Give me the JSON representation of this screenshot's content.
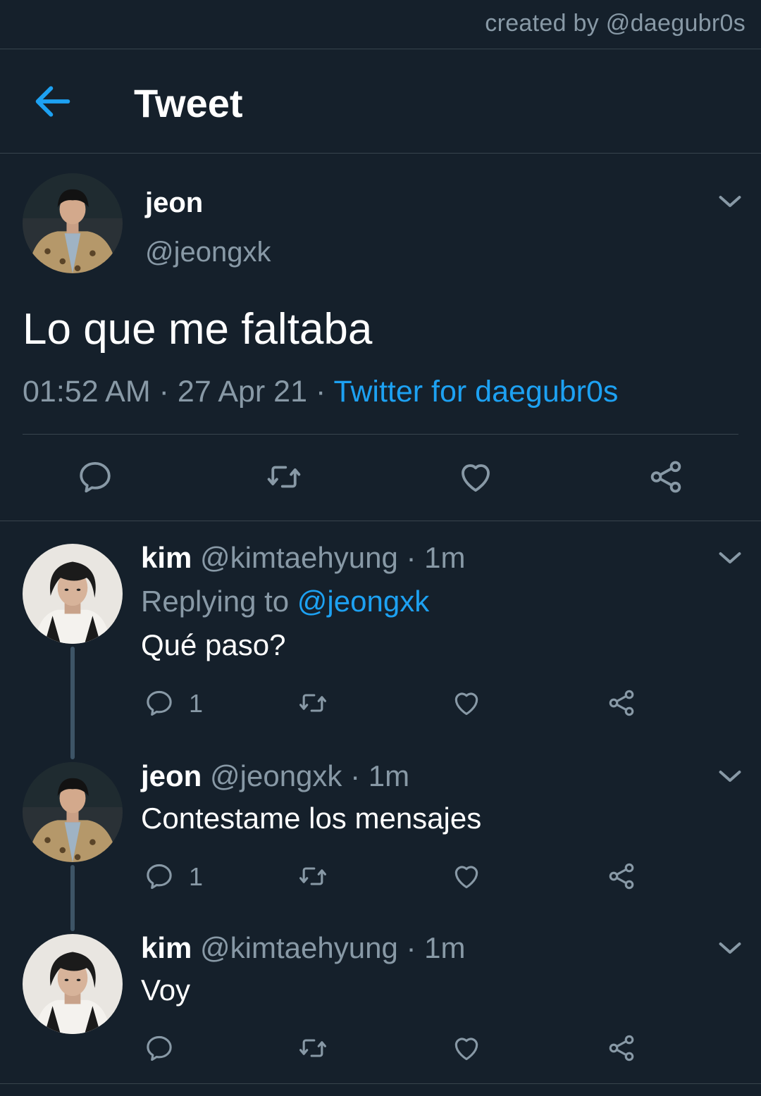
{
  "watermark": "created by @daegubr0s",
  "header": {
    "title": "Tweet"
  },
  "main_tweet": {
    "name": "jeon",
    "handle": "@jeongxk",
    "text": "Lo que me faltaba",
    "time": "01:52 AM",
    "date": "27 Apr 21",
    "separator": "·",
    "source": "Twitter for daegubr0s"
  },
  "replies": [
    {
      "name": "kim",
      "handle": "@kimtaehyung",
      "time": "1m",
      "replying_prefix": "Replying to",
      "replying_to": "@jeongxk",
      "text": "Qué paso?",
      "reply_count": "1"
    },
    {
      "name": "jeon",
      "handle": "@jeongxk",
      "time": "1m",
      "text": "Contestame los mensajes",
      "reply_count": "1"
    },
    {
      "name": "kim",
      "handle": "@kimtaehyung",
      "time": "1m",
      "text": "Voy",
      "reply_count": ""
    }
  ],
  "colors": {
    "background": "#15202b",
    "accent": "#1da1f2",
    "muted": "#8899a6",
    "divider": "#38444d"
  }
}
